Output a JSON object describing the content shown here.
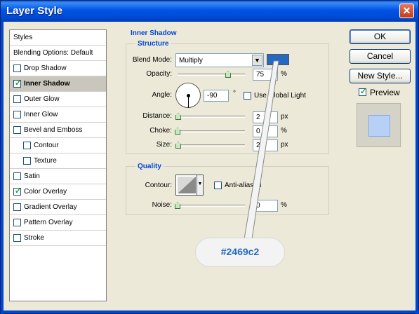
{
  "window": {
    "title": "Layer Style",
    "close_glyph": "✕"
  },
  "styles_panel": {
    "header": "Styles",
    "blending": "Blending Options: Default",
    "items": [
      {
        "label": "Drop Shadow",
        "checked": false,
        "selected": false,
        "indent": false
      },
      {
        "label": "Inner Shadow",
        "checked": true,
        "selected": true,
        "indent": false
      },
      {
        "label": "Outer Glow",
        "checked": false,
        "selected": false,
        "indent": false
      },
      {
        "label": "Inner Glow",
        "checked": false,
        "selected": false,
        "indent": false
      },
      {
        "label": "Bevel and Emboss",
        "checked": false,
        "selected": false,
        "indent": false
      },
      {
        "label": "Contour",
        "checked": false,
        "selected": false,
        "indent": true
      },
      {
        "label": "Texture",
        "checked": false,
        "selected": false,
        "indent": true
      },
      {
        "label": "Satin",
        "checked": false,
        "selected": false,
        "indent": false
      },
      {
        "label": "Color Overlay",
        "checked": true,
        "selected": false,
        "indent": false
      },
      {
        "label": "Gradient Overlay",
        "checked": false,
        "selected": false,
        "indent": false
      },
      {
        "label": "Pattern Overlay",
        "checked": false,
        "selected": false,
        "indent": false
      },
      {
        "label": "Stroke",
        "checked": false,
        "selected": false,
        "indent": false
      }
    ]
  },
  "inner_shadow": {
    "title": "Inner Shadow",
    "structure": {
      "title": "Structure",
      "blend_mode_label": "Blend Mode:",
      "blend_mode_value": "Multiply",
      "color": "#2469c2",
      "opacity_label": "Opacity:",
      "opacity_value": "75",
      "opacity_unit": "%",
      "opacity_level": 0.75,
      "angle_label": "Angle:",
      "angle_value": "-90",
      "angle_unit": "°",
      "use_global_light_label": "Use Global Light",
      "use_global_light_checked": false,
      "distance_label": "Distance:",
      "distance_value": "2",
      "distance_unit": "px",
      "choke_label": "Choke:",
      "choke_value": "0",
      "choke_unit": "%",
      "size_label": "Size:",
      "size_value": "2",
      "size_unit": "px"
    },
    "quality": {
      "title": "Quality",
      "contour_label": "Contour:",
      "anti_aliased_label": "Anti-aliased",
      "anti_aliased_checked": false,
      "noise_label": "Noise:",
      "noise_value": "0",
      "noise_unit": "%"
    }
  },
  "buttons": {
    "ok": "OK",
    "cancel": "Cancel",
    "new_style": "New Style...",
    "preview_label": "Preview",
    "preview_checked": true
  },
  "annotation": {
    "text": "#2469c2"
  }
}
